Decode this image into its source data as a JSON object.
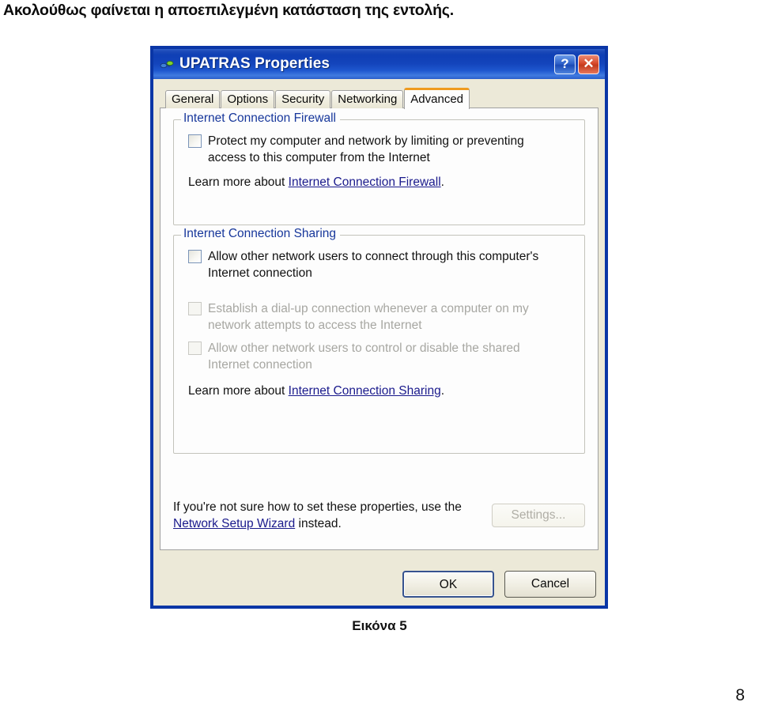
{
  "document": {
    "heading": "Ακολούθως φαίνεται η αποεπιλεγμένη κατάσταση της εντολής.",
    "figure_caption": "Εικόνα 5",
    "page_number": "8"
  },
  "dialog": {
    "title": "UPATRAS Properties",
    "title_icon": "network-connection-icon",
    "help_button": "?",
    "close_button": "✕",
    "tabs": [
      {
        "label": "General",
        "active": false
      },
      {
        "label": "Options",
        "active": false
      },
      {
        "label": "Security",
        "active": false
      },
      {
        "label": "Networking",
        "active": false
      },
      {
        "label": "Advanced",
        "active": true
      }
    ],
    "firewall_group": {
      "legend": "Internet Connection Firewall",
      "checkbox_label": "Protect my computer and network by limiting or preventing access to this computer from the Internet",
      "checked": false,
      "learn_prefix": "Learn more about ",
      "learn_link": "Internet Connection Firewall",
      "learn_suffix": "."
    },
    "sharing_group": {
      "legend": "Internet Connection Sharing",
      "checkbox1_label": "Allow other network users to connect through this computer's Internet connection",
      "checkbox1_checked": false,
      "checkbox2_label": "Establish a dial-up connection whenever a computer on my network attempts to access the Internet",
      "checkbox2_checked": false,
      "checkbox2_disabled": true,
      "checkbox3_label": "Allow other network users to control or disable the shared Internet connection",
      "checkbox3_checked": false,
      "checkbox3_disabled": true,
      "learn_prefix": "Learn more about ",
      "learn_link": "Internet Connection Sharing",
      "learn_suffix": "."
    },
    "footer": {
      "hint_prefix": "If you're not sure how to set these properties, use the ",
      "hint_link": "Network Setup Wizard",
      "hint_suffix": " instead.",
      "settings_button": "Settings...",
      "settings_disabled": true
    },
    "buttons": {
      "ok": "OK",
      "cancel": "Cancel"
    },
    "colors": {
      "titlebar_blue": "#0f3fb5",
      "window_border": "#0a36a6",
      "face": "#ece9d8",
      "active_tab_accent": "#ef9b20",
      "legend_text": "#17379b",
      "link_text": "#1a1a8c",
      "close_red": "#c23a1d"
    }
  }
}
